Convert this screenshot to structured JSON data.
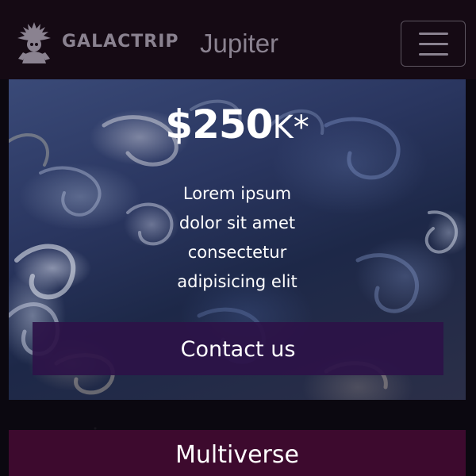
{
  "header": {
    "brand": "GALACTRIP",
    "planet": "Jupiter",
    "logo_icon": "astronaut-emblem-icon",
    "menu_icon": "hamburger-icon"
  },
  "hero": {
    "price_amount": "$250",
    "price_suffix": "K*",
    "text_lines": [
      "Lorem ipsum",
      "dolor sit amet",
      "consectetur",
      "adipisicing elit"
    ],
    "cta_label": "Contact us",
    "background": "jupiter-clouds-image"
  },
  "section": {
    "title": "Multiverse"
  },
  "colors": {
    "header_bg": "#150a14",
    "cta_bg": "#2d1248",
    "section_bg": "#3d0a2e",
    "muted_text": "#8a8290"
  }
}
